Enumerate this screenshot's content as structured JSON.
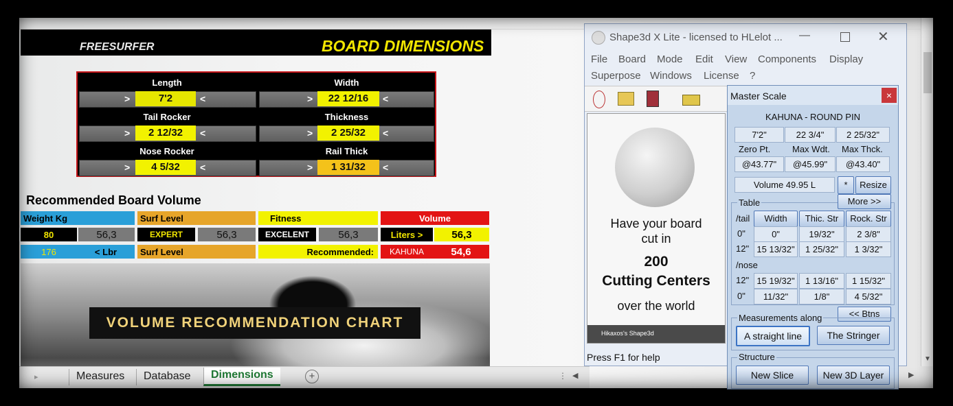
{
  "header": {
    "left": "FREESURFER",
    "right": "BOARD DIMENSIONS"
  },
  "dimensions": [
    {
      "label": "Length",
      "value": "7'2",
      "color": "#e6e600"
    },
    {
      "label": "Width",
      "value": "22 12/16",
      "color": "#f2f200"
    },
    {
      "label": "Tail  Rocker",
      "value": "2 12/32",
      "color": "#f2f200"
    },
    {
      "label": "Thickness",
      "value": "2 25/32",
      "color": "#f2f200"
    },
    {
      "label": "Nose Rocker",
      "value": "4 5/32",
      "color": "#f2f200"
    },
    {
      "label": "Rail Thick",
      "value": "1 31/32",
      "color": "#f4c21a"
    }
  ],
  "volume": {
    "title": "Recommended Board Volume",
    "weight_label": "Weight Kg",
    "weight": "80",
    "weight_calc": "56,3",
    "lbs": "176",
    "lbs_label": "< Lbr",
    "surf_level_label": "Surf Level",
    "surf_level": "EXPERT",
    "surf_level_calc": "56,3",
    "surf_level_label2": "Surf Level",
    "fitness_label": "Fitness",
    "fitness": "EXCELENT",
    "fitness_calc": "56,3",
    "recommended_label": "Recommended:",
    "volume_label": "Volume",
    "liters_label": "Liters >",
    "liters": "56,3",
    "model": "KAHUNA",
    "model_value": "54,6"
  },
  "banner": "VOLUME RECOMMENDATION CHART",
  "sheet_tabs": [
    "Measures",
    "Database",
    "Dimensions"
  ],
  "shape3d": {
    "title": "Shape3d X Lite - licensed to HLelot ...",
    "menus": [
      "File",
      "Board",
      "Mode",
      "Edit",
      "View",
      "Components",
      "Display",
      "Superpose",
      "Windows",
      "License",
      "?"
    ],
    "ad": {
      "line1": "Have your board",
      "line2": "cut in",
      "line3": "200",
      "line4": "Cutting Centers",
      "line5": "over the world",
      "footer": "Hikaxos's Shape3d"
    },
    "status": "Press F1 for help"
  },
  "master_scale": {
    "title": "Master Scale",
    "close": "×",
    "model": "KAHUNA - ROUND PIN",
    "dims": [
      "7'2\"",
      "22 3/4\"",
      "2 25/32\""
    ],
    "headers": [
      "Zero Pt.",
      "Max Wdt.",
      "Max Thck."
    ],
    "positions": [
      "@43.77\"",
      "@45.99\"",
      "@43.40\""
    ],
    "volume": "Volume 49.95 L",
    "star": "*",
    "resize": "Resize",
    "table_label": "Table",
    "more": "More >>",
    "tail_label": "/tail",
    "nose_label": "/nose",
    "col_headers": [
      "Width",
      "Thic. Str",
      "Rock. Str"
    ],
    "tail_rows": [
      {
        "pos": "0\"",
        "w": "0\"",
        "t": "19/32\"",
        "r": "2 3/8\""
      },
      {
        "pos": "12\"",
        "w": "15 13/32\"",
        "t": "1 25/32\"",
        "r": "1 3/32\""
      }
    ],
    "nose_rows": [
      {
        "pos": "12\"",
        "w": "15 19/32\"",
        "t": "1 13/16\"",
        "r": "1 15/32\""
      },
      {
        "pos": "0\"",
        "w": "11/32\"",
        "t": "1/8\"",
        "r": "4 5/32\""
      }
    ],
    "btns": "<< Btns",
    "measure_label": "Measurements along",
    "straight": "A straight line",
    "stringer": "The Stringer",
    "structure_label": "Structure",
    "new_slice": "New Slice",
    "new_layer": "New 3D Layer"
  }
}
